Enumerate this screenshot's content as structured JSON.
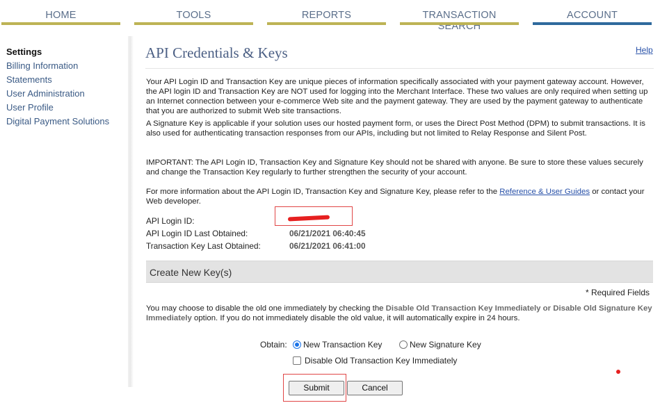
{
  "nav": {
    "home": "HOME",
    "tools": "TOOLS",
    "reports": "REPORTS",
    "transaction_search": "TRANSACTION SEARCH",
    "account": "ACCOUNT"
  },
  "sidebar": {
    "items": [
      {
        "label": "Settings"
      },
      {
        "label": "Billing Information"
      },
      {
        "label": "Statements"
      },
      {
        "label": "User Administration"
      },
      {
        "label": "User Profile"
      },
      {
        "label": "Digital Payment Solutions"
      }
    ]
  },
  "page": {
    "title": "API Credentials & Keys",
    "help": "Help"
  },
  "content": {
    "intro": "Your API Login ID and Transaction Key are unique pieces of information specifically associated with your payment gateway account. However, the API login ID and Transaction Key are NOT used for logging into the Merchant Interface. These two values are only required when setting up an Internet connection between your e-commerce Web site and the payment gateway. They are used by the payment gateway to authenticate that you are authorized to submit Web site transactions.",
    "signature_info": "A Signature Key is applicable if your solution uses our hosted payment form, or uses the Direct Post Method (DPM) to submit transactions. It is also used for authenticating transaction responses from our APIs, including but not limited to Relay Response and Silent Post.",
    "important": "IMPORTANT: The API Login ID, Transaction Key and Signature Key should not be shared with anyone. Be sure to store these values securely and change the Transaction Key regularly to further strengthen the security of your account.",
    "more_info_prefix": "For more information about the API Login ID, Transaction Key and Signature Key, please refer to the ",
    "more_info_link": "Reference & User Guides",
    "more_info_suffix": " or contact your Web developer."
  },
  "credentials": {
    "login_id_label": "API Login ID:",
    "login_id_value": "",
    "login_last_label": "API Login ID Last Obtained:",
    "login_last_value": "06/21/2021 06:40:45",
    "txkey_last_label": "Transaction Key Last Obtained:",
    "txkey_last_value": "06/21/2021 06:41:00"
  },
  "new_key": {
    "section_title": "Create New Key(s)",
    "required_note": "* Required Fields",
    "desc_prefix": "You may choose to disable the old one immediately by checking the ",
    "desc_strong": "Disable Old Transaction Key Immediately or Disable Old Signature Key Immediately",
    "desc_suffix": " option. If you do not immediately disable the old value, it will automatically expire in 24 hours.",
    "obtain_label": "Obtain:",
    "option_transaction": "New Transaction Key",
    "option_signature": "New Signature Key",
    "disable_old": "Disable Old Transaction Key Immediately",
    "selected": "New Transaction Key"
  },
  "buttons": {
    "submit": "Submit",
    "cancel": "Cancel"
  },
  "colors": {
    "nav_bar": "#bdb355",
    "nav_active": "#2f6a9d",
    "title": "#4b5f84",
    "annotation_red": "#e04545"
  }
}
